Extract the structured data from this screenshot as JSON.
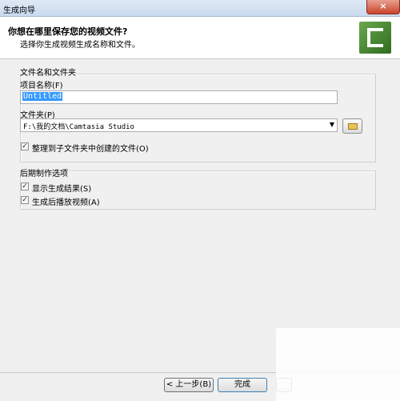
{
  "window": {
    "title": "生成向导",
    "close_glyph": "×"
  },
  "header": {
    "title": "你想在哪里保存您的视频文件?",
    "subtitle": "选择你生成视频生成名称和文件。",
    "logo_icon": "camtasia-logo-icon",
    "logo_color": "#4a8f3a"
  },
  "file_group": {
    "label": "文件名和文件夹",
    "project_name_label": "项目名称(F)",
    "project_name_value": "Untitled",
    "folder_label": "文件夹(P)",
    "folder_value": "F:\\我的文档\\Camtasia Studio",
    "browse_icon": "folder-open-icon",
    "organize_label": "整理到子文件夹中创建的文件(O)",
    "organize_checked": true
  },
  "post_group": {
    "label": "后期制作选项",
    "show_results_label": "显示生成结果(S)",
    "show_results_checked": true,
    "play_after_label": "生成后播放视频(A)",
    "play_after_checked": true
  },
  "footer": {
    "back_label": "< 上一步(B)",
    "finish_label": "完成"
  }
}
